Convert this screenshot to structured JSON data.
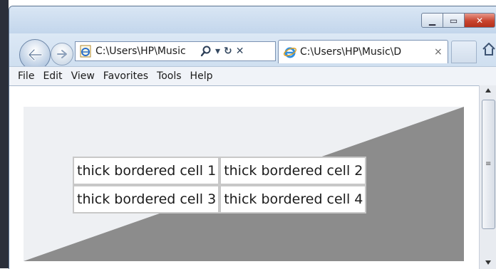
{
  "window": {
    "caption": {
      "minimize_icon": "minimize-icon",
      "maximize_icon": "maximize-icon",
      "close_icon": "close-icon"
    }
  },
  "navigation": {
    "address_text": "C:\\Users\\HP\\Music",
    "tab_title": "C:\\Users\\HP\\Music\\D",
    "tab_close": "×"
  },
  "menu": [
    "File",
    "Edit",
    "View",
    "Favorites",
    "Tools",
    "Help"
  ],
  "table": {
    "cells": [
      [
        "thick bordered cell 1",
        "thick bordered cell 2"
      ],
      [
        "thick bordered cell 3",
        "thick bordered cell 4"
      ]
    ],
    "colors": {
      "light_bevel": "#eef0f3",
      "dark_bevel": "#8c8c8c",
      "cell_border": "#c8c8c8"
    }
  },
  "colors": {
    "close_button": "#c8442f",
    "chrome": "#c8daee"
  }
}
